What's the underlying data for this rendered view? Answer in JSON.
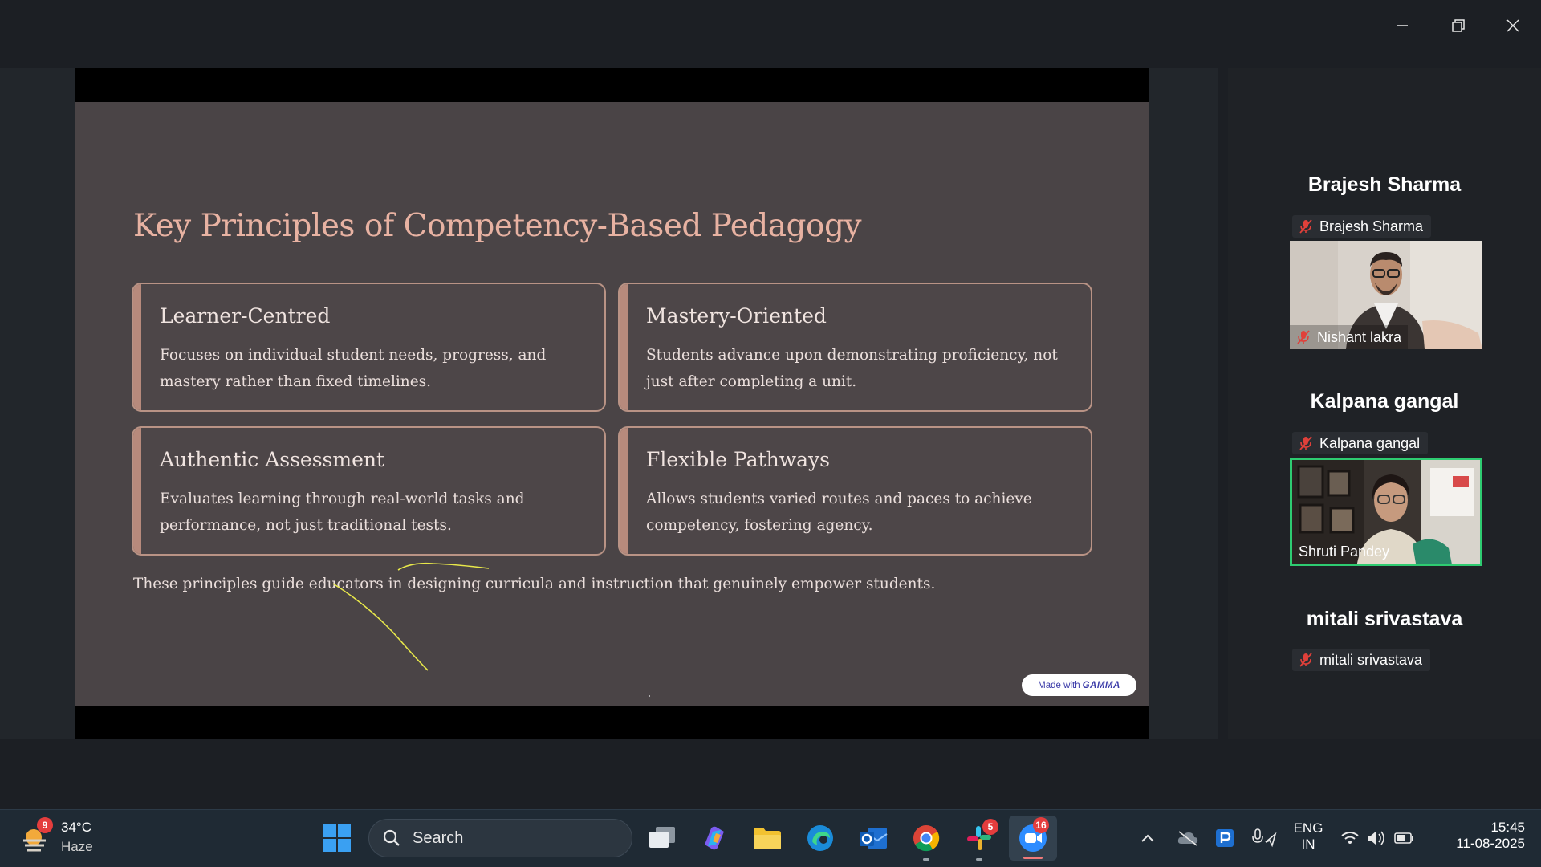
{
  "window_controls": {
    "minimize_icon": "minimize-icon",
    "restore_icon": "restore-icon",
    "close_icon": "close-icon"
  },
  "slide": {
    "title": "Key Principles of Competency-Based Pedagogy",
    "cards": [
      {
        "heading": "Learner-Centred",
        "body": "Focuses on individual student needs, progress, and mastery rather than fixed timelines."
      },
      {
        "heading": "Mastery-Oriented",
        "body": "Students advance upon demonstrating proficiency, not just after completing a unit."
      },
      {
        "heading": "Authentic Assessment",
        "body": "Evaluates learning through real-world tasks and performance, not just traditional tests."
      },
      {
        "heading": "Flexible Pathways",
        "body": "Allows students varied routes and paces to achieve competency, fostering agency."
      }
    ],
    "footer": "These principles guide educators in designing curricula and instruction that genuinely empower students.",
    "badge_prefix": "Made with",
    "badge_brand": "GAMMA"
  },
  "participants": [
    {
      "name": "Brajesh Sharma",
      "tag": "Brajesh Sharma"
    },
    {
      "name": "Kalpana gangal",
      "tag": "Kalpana gangal"
    },
    {
      "name": "mitali srivastava",
      "tag": "mitali srivastava"
    }
  ],
  "videos": [
    {
      "label": "Nishant lakra"
    },
    {
      "label": "Shruti Pandey"
    }
  ],
  "taskbar": {
    "weather": {
      "temp": "34°C",
      "condition": "Haze",
      "badge": "9"
    },
    "search_placeholder": "Search",
    "slack_badge": "5",
    "zoom_badge": "16",
    "language": {
      "line1": "ENG",
      "line2": "IN"
    },
    "time": "15:45",
    "date": "11-08-2025"
  },
  "colors": {
    "accent_green": "#2ecc71",
    "slide_bg": "#4a4446",
    "title": "#e8b2a2",
    "taskbar": "#1f2a34"
  }
}
